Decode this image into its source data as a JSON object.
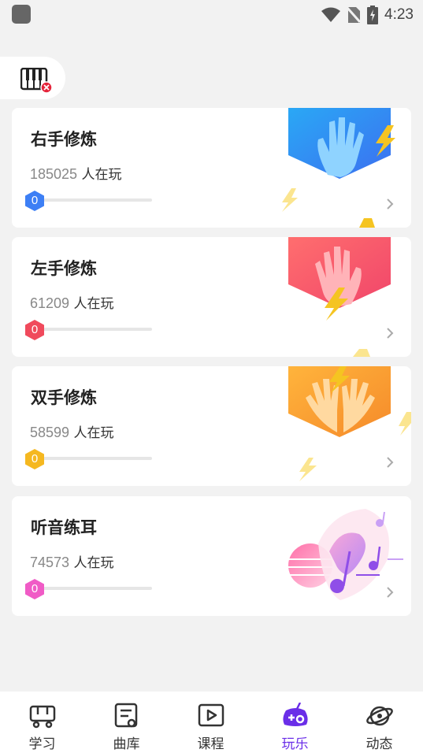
{
  "status_bar": {
    "time": "4:23"
  },
  "cards": [
    {
      "title": "右手修炼",
      "players_count": "185025",
      "players_suffix": " 人在玩",
      "level": "0",
      "level_color": "#3d7ff5"
    },
    {
      "title": "左手修炼",
      "players_count": "61209",
      "players_suffix": " 人在玩",
      "level": "0",
      "level_color": "#f04a5c"
    },
    {
      "title": "双手修炼",
      "players_count": "58599",
      "players_suffix": " 人在玩",
      "level": "0",
      "level_color": "#f5b820"
    },
    {
      "title": "听音练耳",
      "players_count": "74573",
      "players_suffix": " 人在玩",
      "level": "0",
      "level_color": "#f05bc6"
    }
  ],
  "nav": [
    {
      "label": "学习",
      "icon": "study-icon"
    },
    {
      "label": "曲库",
      "icon": "library-icon"
    },
    {
      "label": "课程",
      "icon": "course-icon"
    },
    {
      "label": "玩乐",
      "icon": "play-icon",
      "active": true
    },
    {
      "label": "动态",
      "icon": "planet-icon"
    }
  ],
  "colors": {
    "accent": "#6a2ee8"
  }
}
